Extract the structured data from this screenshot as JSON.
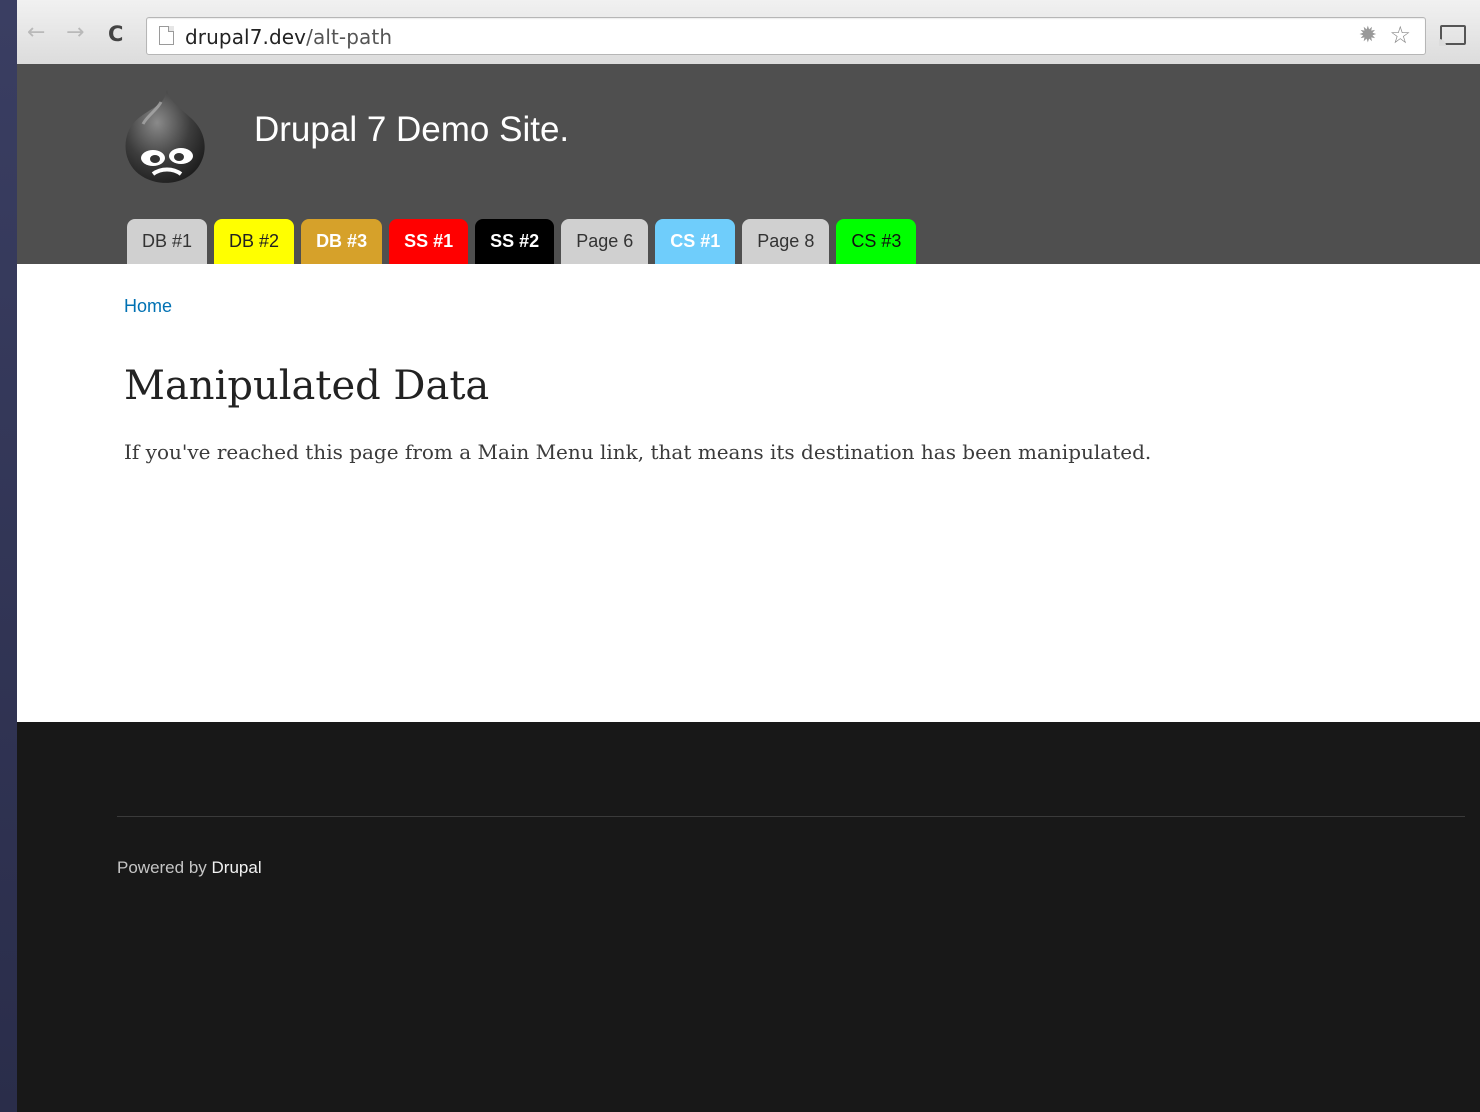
{
  "browser": {
    "url_host": "drupal7.dev",
    "url_path": "/alt-path"
  },
  "site": {
    "name": "Drupal 7 Demo Site."
  },
  "main_menu": [
    {
      "label": "DB #1",
      "color": "#d0d0d0"
    },
    {
      "label": "DB #2",
      "color": "#ffff00"
    },
    {
      "label": "DB #3",
      "color": "#d6a12a"
    },
    {
      "label": "SS #1",
      "color": "#ff0000"
    },
    {
      "label": "SS #2",
      "color": "#000000"
    },
    {
      "label": "Page 6",
      "color": "#d0d0d0"
    },
    {
      "label": "CS #1",
      "color": "#6fcdfb"
    },
    {
      "label": "Page 8",
      "color": "#d0d0d0"
    },
    {
      "label": "CS #3",
      "color": "#00ff00"
    }
  ],
  "breadcrumb": {
    "home": "Home"
  },
  "content": {
    "title": "Manipulated Data",
    "body": "If you've reached this page from a Main Menu link, that means its destination has been manipulated."
  },
  "footer": {
    "powered_prefix": "Powered by",
    "powered_link": "Drupal"
  }
}
